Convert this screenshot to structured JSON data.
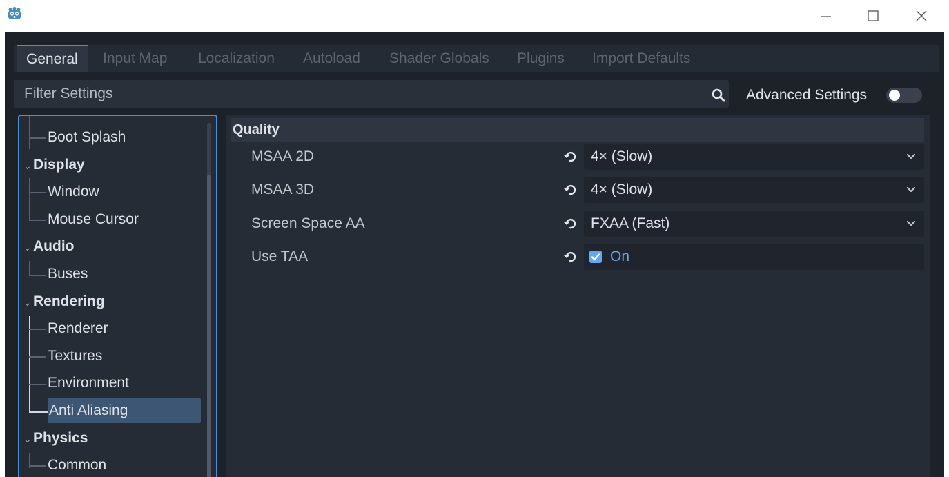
{
  "tabs": [
    {
      "label": "General",
      "active": true
    },
    {
      "label": "Input Map"
    },
    {
      "label": "Localization"
    },
    {
      "label": "Autoload"
    },
    {
      "label": "Shader Globals"
    },
    {
      "label": "Plugins"
    },
    {
      "label": "Import Defaults"
    }
  ],
  "filter": {
    "placeholder": "Filter Settings"
  },
  "advanced": {
    "label": "Advanced Settings",
    "enabled": false
  },
  "tree": {
    "boot_splash": "Boot Splash",
    "display": "Display",
    "window": "Window",
    "mouse_cursor": "Mouse Cursor",
    "audio": "Audio",
    "buses": "Buses",
    "rendering": "Rendering",
    "renderer": "Renderer",
    "textures": "Textures",
    "environment": "Environment",
    "anti_aliasing": "Anti Aliasing",
    "physics": "Physics",
    "common": "Common"
  },
  "inspector": {
    "section": "Quality",
    "msaa_2d": {
      "label": "MSAA 2D",
      "value": "4× (Slow)"
    },
    "msaa_3d": {
      "label": "MSAA 3D",
      "value": "4× (Slow)"
    },
    "screen_space_aa": {
      "label": "Screen Space AA",
      "value": "FXAA (Fast)"
    },
    "use_taa": {
      "label": "Use TAA",
      "value": "On",
      "checked": true
    }
  },
  "colors": {
    "accent": "#4a90d9",
    "checkbox": "#62a9f2",
    "selection": "#3c5673",
    "background": "#1d2229"
  }
}
